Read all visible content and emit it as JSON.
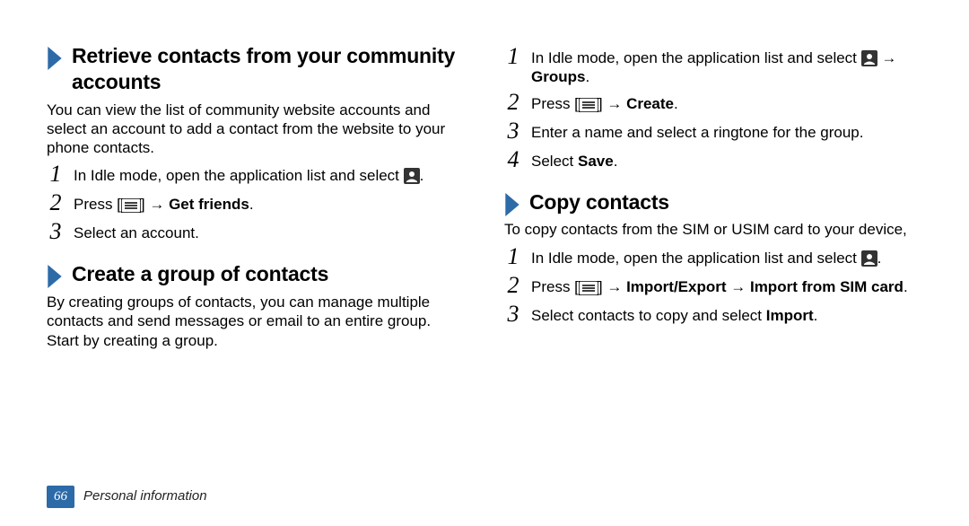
{
  "page": {
    "number": "66",
    "section": "Personal information"
  },
  "left": {
    "sec1": {
      "heading": "Retrieve contacts from your community accounts",
      "intro": "You can view the list of community website accounts and select an account to add a contact from the website to your phone contacts.",
      "steps": {
        "s1_a": "In Idle mode, open the application list and select ",
        "s1_b": ".",
        "s2_a": "Press [",
        "s2_b": "] → ",
        "s2_bold": "Get friends",
        "s2_c": ".",
        "s3": "Select an account."
      }
    },
    "sec2": {
      "heading": "Create a group of contacts",
      "intro": "By creating groups of contacts, you can manage multiple contacts and send messages or email to an entire group. Start by creating a group."
    }
  },
  "right": {
    "sec2steps": {
      "s1_a": "In Idle mode, open the application list and select ",
      "s1_b": " → ",
      "s1_bold": "Groups",
      "s1_c": ".",
      "s2_a": "Press [",
      "s2_b": "] → ",
      "s2_bold": "Create",
      "s2_c": ".",
      "s3": "Enter a name and select a ringtone for the group.",
      "s4_a": "Select ",
      "s4_bold": "Save",
      "s4_b": "."
    },
    "sec3": {
      "heading": "Copy contacts",
      "intro": "To copy contacts from the SIM or USIM card to your device,",
      "steps": {
        "s1_a": "In Idle mode, open the application list and select ",
        "s1_b": ".",
        "s2_a": "Press [",
        "s2_b": "] → ",
        "s2_bold": "Import/Export → Import from SIM card",
        "s2_c": ".",
        "s3_a": "Select contacts to copy and select ",
        "s3_bold": "Import",
        "s3_b": "."
      }
    }
  }
}
